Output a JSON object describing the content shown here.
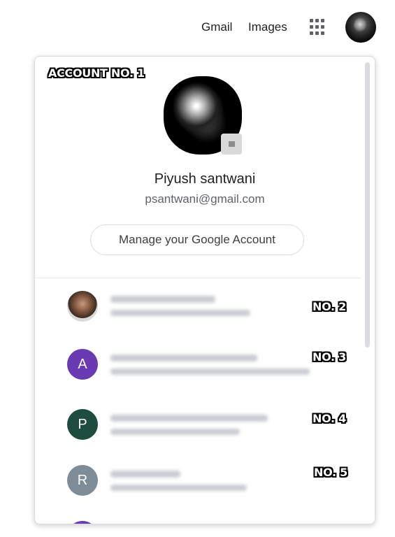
{
  "header": {
    "gmail_label": "Gmail",
    "images_label": "Images",
    "apps_icon": "apps-grid-icon"
  },
  "account_panel": {
    "overlay_labels": [
      "ACCOUNT NO. 1",
      "NO. 2",
      "NO. 3",
      "NO. 4",
      "NO. 5"
    ],
    "current_user": {
      "name": "Piyush santwani",
      "email": "psantwani@gmail.com"
    },
    "manage_button_label": "Manage your Google Account",
    "other_accounts": [
      {
        "initial": "",
        "avatar_color": "#8a5e45",
        "photo": true
      },
      {
        "initial": "A",
        "avatar_color": "#6a3ab2"
      },
      {
        "initial": "P",
        "avatar_color": "#1e4d3f"
      },
      {
        "initial": "R",
        "avatar_color": "#7e8c97"
      },
      {
        "initial": "",
        "avatar_color": "#6a3ab2"
      }
    ]
  }
}
